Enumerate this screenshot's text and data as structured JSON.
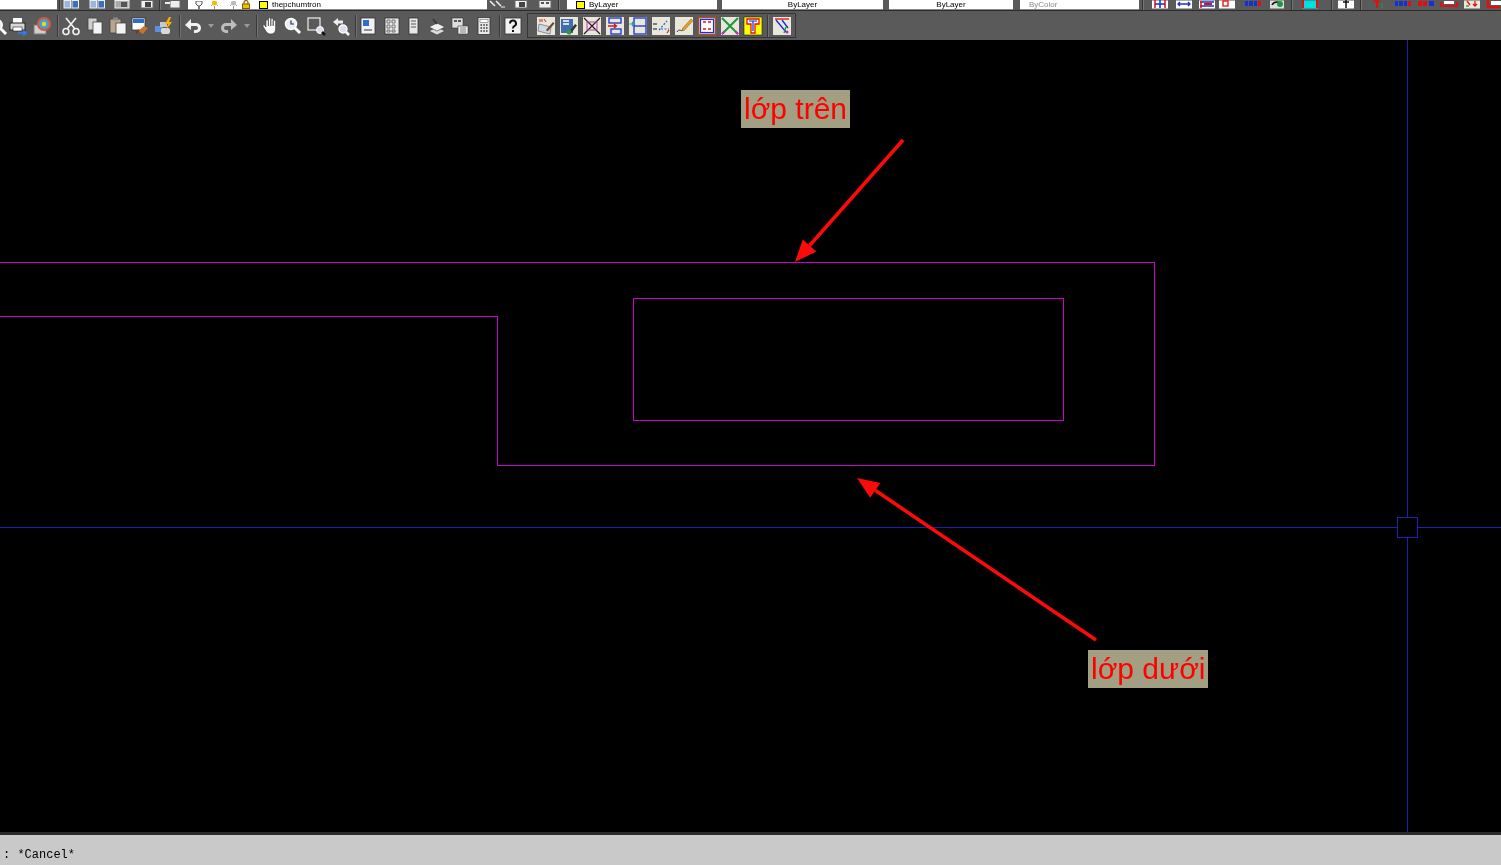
{
  "top_toolbar": {
    "layer": {
      "value": "thepchumtron",
      "color": "#ffff00"
    },
    "properties": [
      {
        "kind": "swatch",
        "value": "ByLayer",
        "color": "#ffff00",
        "disabled": false
      },
      {
        "kind": "centered",
        "value": "ByLayer",
        "disabled": false
      },
      {
        "kind": "centered",
        "value": "ByLayer",
        "disabled": false
      },
      {
        "kind": "left",
        "value": "ByColor",
        "disabled": true
      }
    ]
  },
  "drawing": {
    "annotations": [
      {
        "label": "lớp trên"
      },
      {
        "label": "lớp dưới"
      }
    ]
  },
  "command_line": {
    "text": ": *Cancel*"
  }
}
